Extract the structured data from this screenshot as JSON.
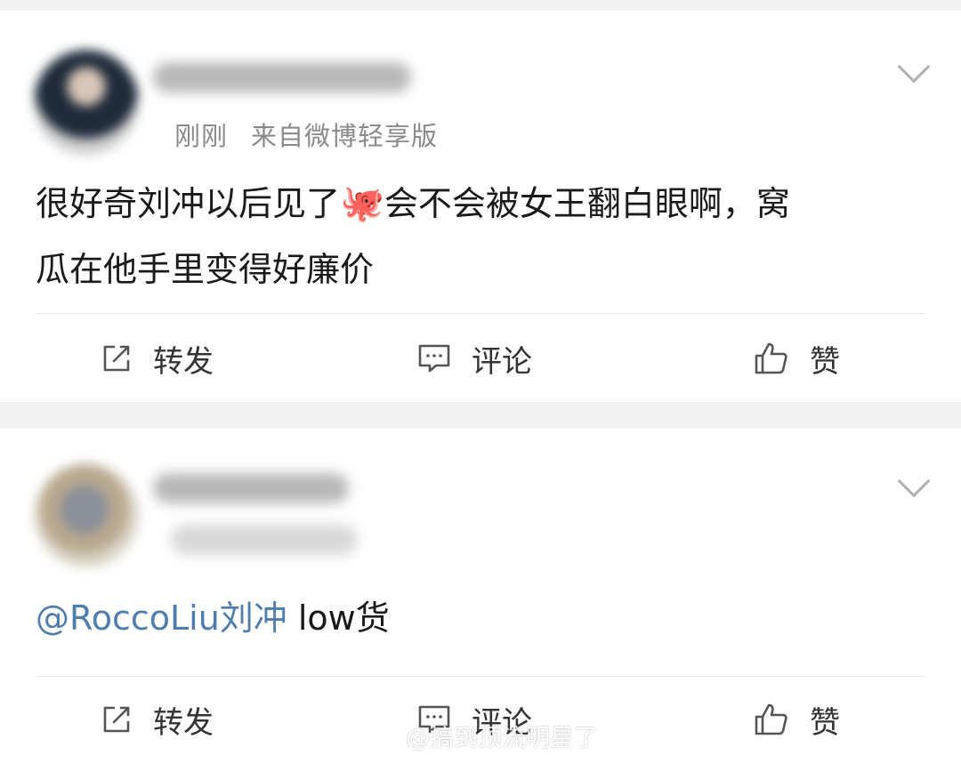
{
  "posts": [
    {
      "time": "刚刚",
      "source": "来自微博轻享版",
      "content_before_emoji": "很好奇刘冲以后见了",
      "emoji": "🐙",
      "content_after_emoji": "会不会被女王翻白眼啊，窝",
      "content_line2": "瓜在他手里变得好廉价",
      "actions": {
        "repost": "转发",
        "comment": "评论",
        "like": "赞"
      }
    },
    {
      "mention": "@RoccoLiu刘冲",
      "content": " low货",
      "actions": {
        "repost": "转发",
        "comment": "评论",
        "like": "赞"
      }
    }
  ],
  "watermark": "@搞到顶流明星了",
  "colors": {
    "mention": "#507daf",
    "background": "#f2f2f2",
    "card": "#ffffff",
    "meta": "#8a8a8a"
  }
}
